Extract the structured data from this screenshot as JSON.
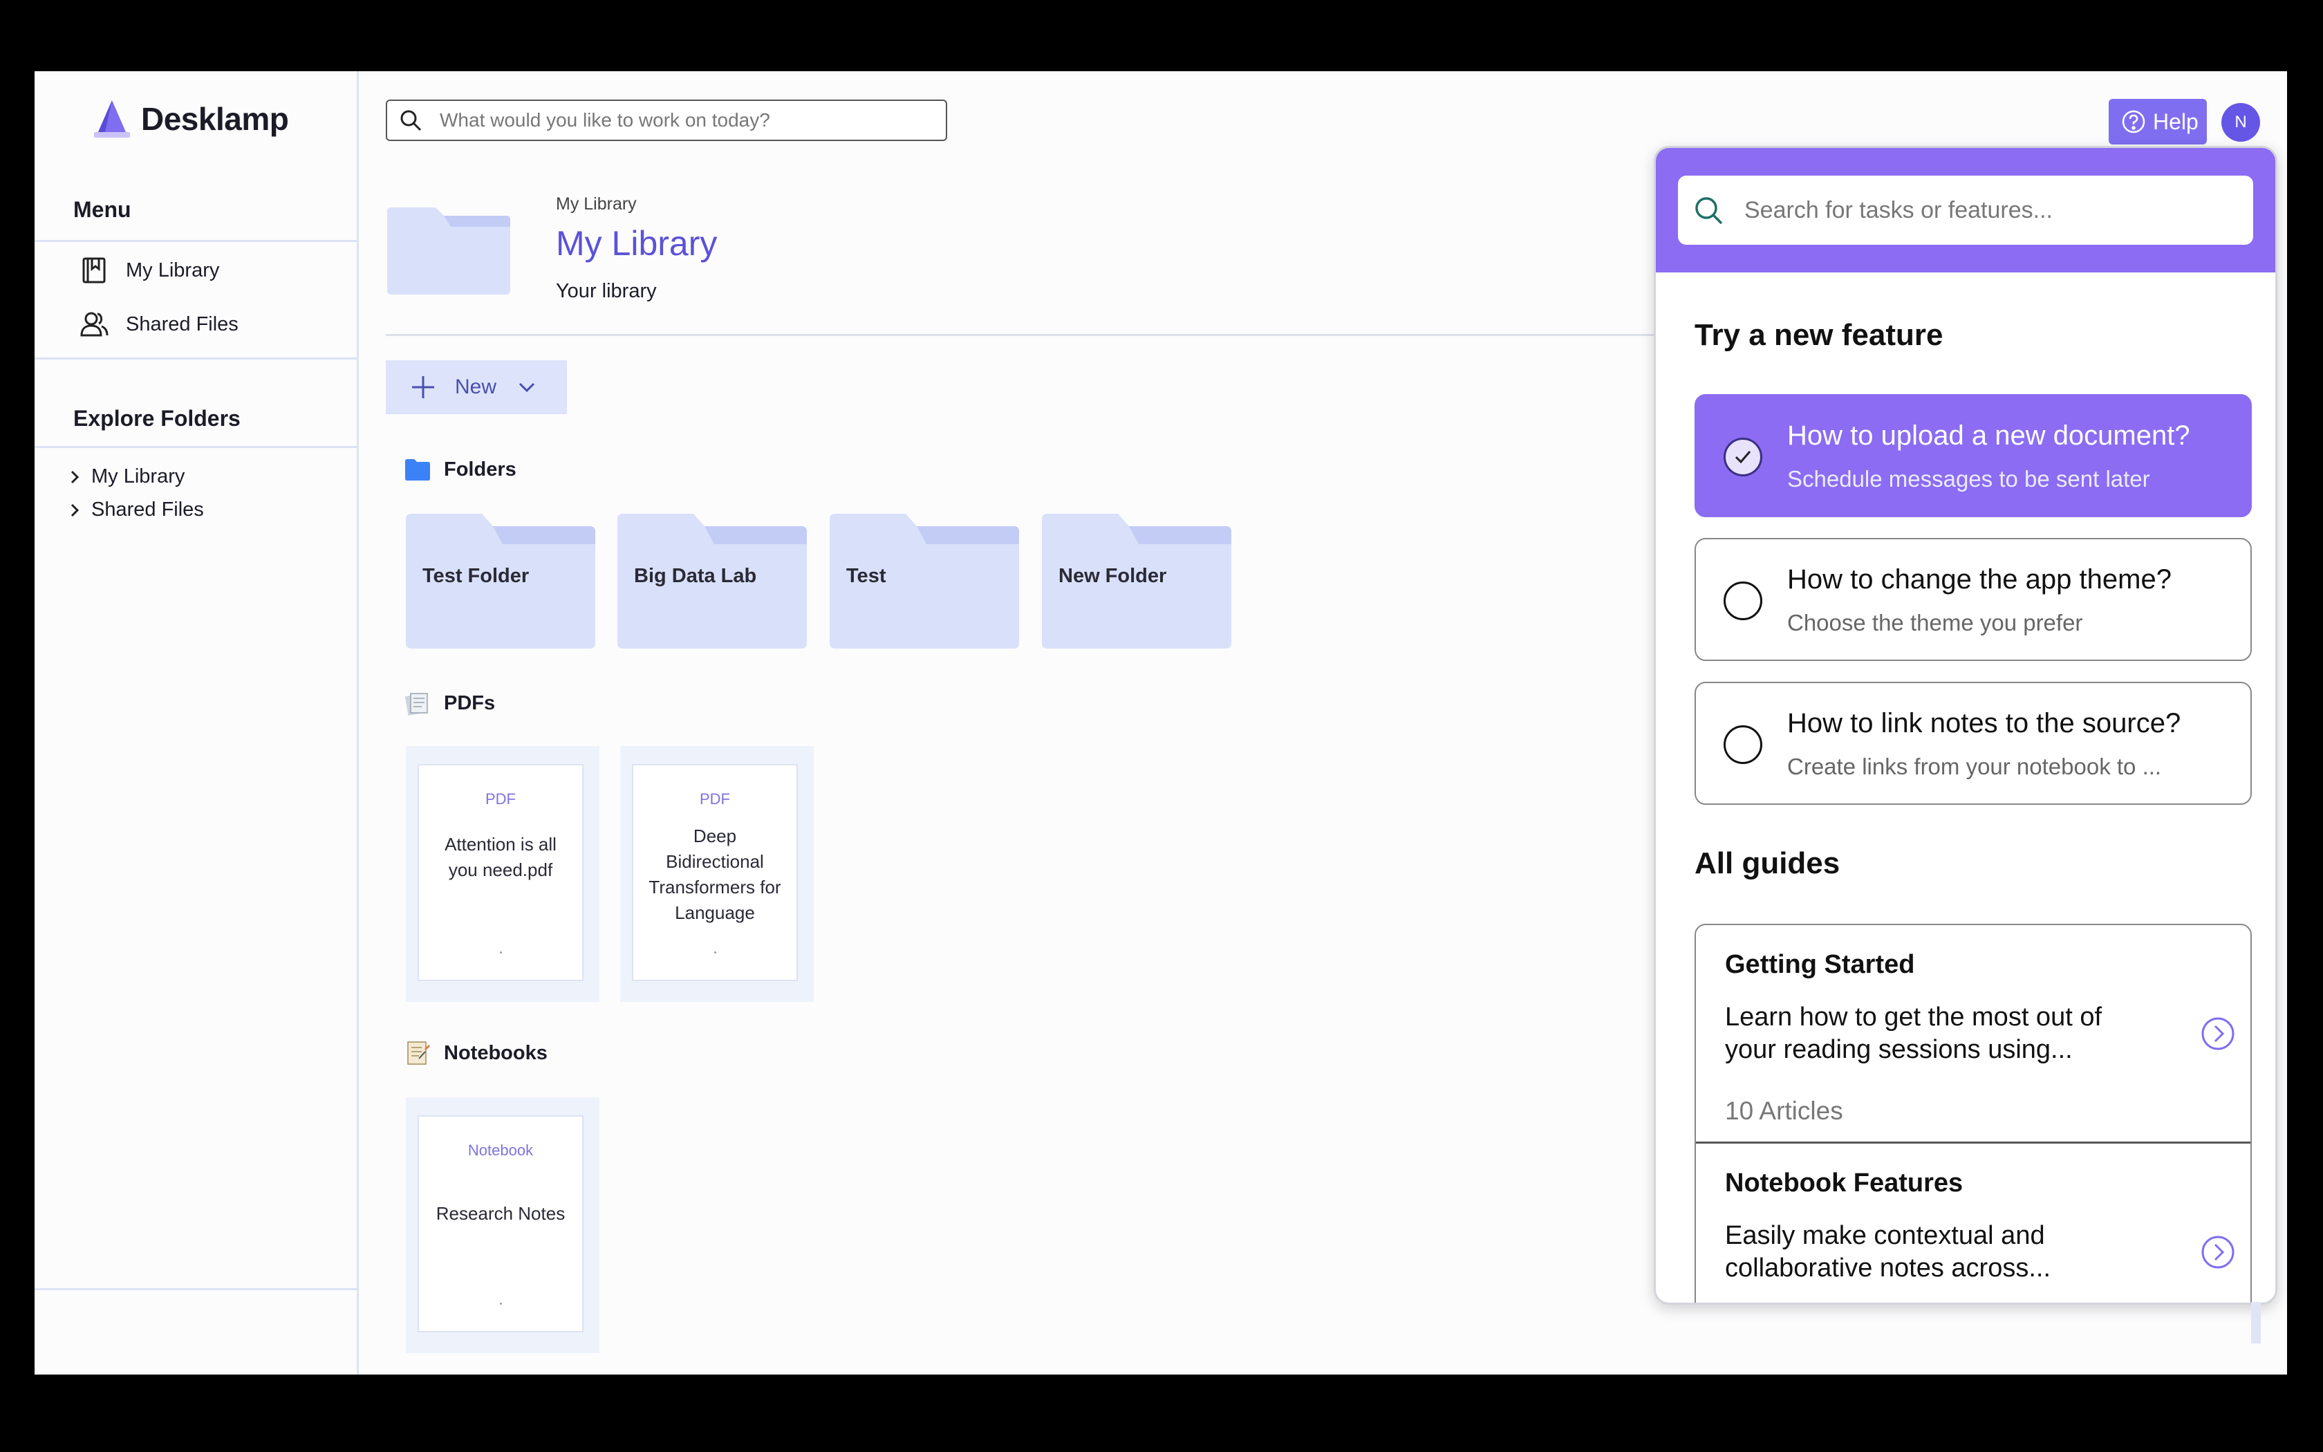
{
  "app": {
    "name": "Desklamp"
  },
  "sidebar": {
    "menu_heading": "Menu",
    "menu_items": [
      {
        "label": "My Library",
        "icon": "book-icon"
      },
      {
        "label": "Shared Files",
        "icon": "users-icon"
      }
    ],
    "explore_heading": "Explore Folders",
    "tree_items": [
      {
        "label": "My Library"
      },
      {
        "label": "Shared Files"
      }
    ]
  },
  "search": {
    "placeholder": "What would you like to work on today?"
  },
  "header": {
    "breadcrumb": "My Library",
    "title": "My Library",
    "subtitle": "Your library"
  },
  "toolbar": {
    "new_label": "New"
  },
  "sections": {
    "folders": {
      "title": "Folders",
      "items": [
        "Test Folder",
        "Big Data Lab",
        "Test",
        "New Folder"
      ]
    },
    "pdfs": {
      "title": "PDFs",
      "items": [
        {
          "type": "PDF",
          "name": "Attention is all you need.pdf"
        },
        {
          "type": "PDF",
          "name": "Deep Bidirectional Transformers for Language"
        }
      ]
    },
    "notebooks": {
      "title": "Notebooks",
      "items": [
        {
          "type": "Notebook",
          "name": "Research Notes"
        }
      ]
    }
  },
  "topbar": {
    "help_label": "Help",
    "avatar_initial": "N"
  },
  "help_panel": {
    "search_placeholder": "Search for tasks or features...",
    "try_heading": "Try a new feature",
    "features": [
      {
        "title": "How to upload a new document?",
        "subtitle": "Schedule messages to be sent later",
        "checked": true
      },
      {
        "title": "How to change the app theme?",
        "subtitle": "Choose the theme you prefer",
        "checked": false
      },
      {
        "title": "How to link notes to the source?",
        "subtitle": "Create links from your notebook to ...",
        "checked": false
      }
    ],
    "guides_heading": "All guides",
    "guides": [
      {
        "title": "Getting Started",
        "desc": "Learn how to get the most out of your reading sessions using...",
        "count": "10 Articles"
      },
      {
        "title": "Notebook Features",
        "desc": "Easily make contextual and collaborative notes across..."
      }
    ]
  },
  "colors": {
    "accent": "#8b6cf2",
    "brand_text": "#5b52d6",
    "folder": "#d9e0fa",
    "folder_tab": "#c3ccf5"
  }
}
